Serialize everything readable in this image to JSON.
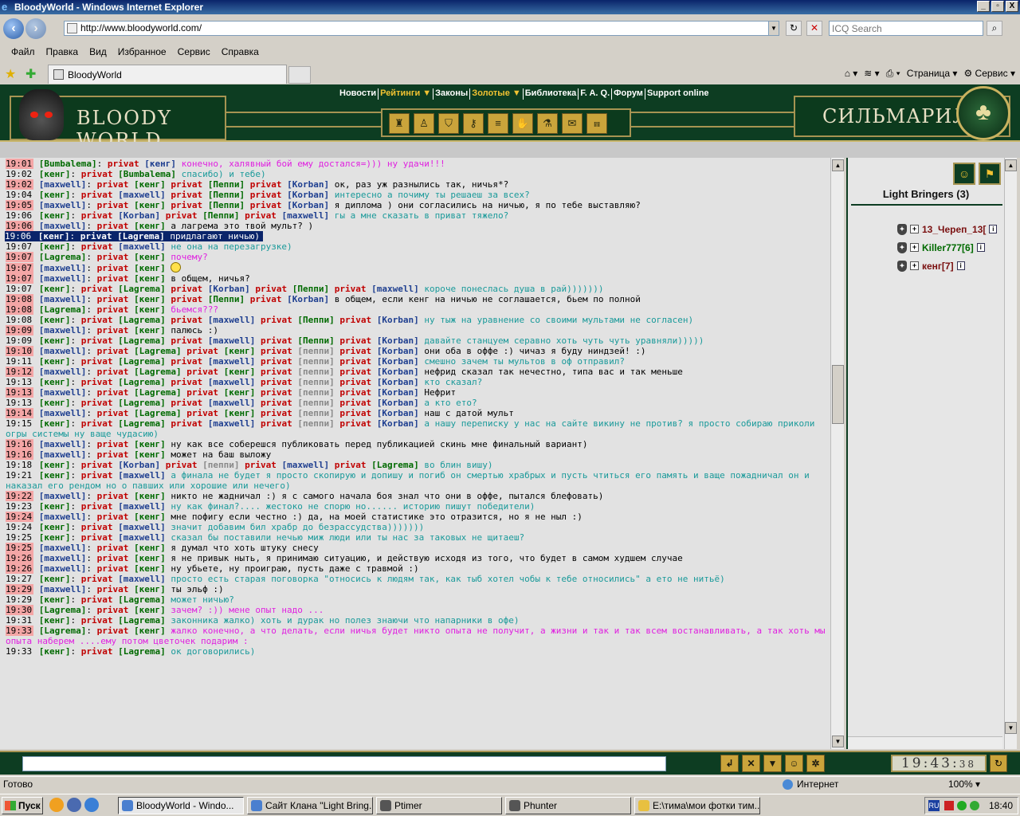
{
  "window": {
    "title": "BloodyWorld - Windows Internet Explorer",
    "controls": [
      "_",
      "▫",
      "X"
    ]
  },
  "address": {
    "url": "http://www.bloodyworld.com/",
    "search_placeholder": "ICQ Search"
  },
  "menu": [
    "Файл",
    "Правка",
    "Вид",
    "Избранное",
    "Сервис",
    "Справка"
  ],
  "tab": {
    "label": "BloodyWorld"
  },
  "ie_tools": {
    "page_label": "Страница",
    "service_label": "Сервис"
  },
  "site": {
    "nav": [
      "Новости",
      "Рейтинги ▼",
      "Законы",
      "Золотые ▼",
      "Библиотека",
      "F. A. Q.",
      "Форум",
      "Support online"
    ],
    "brand_left": "BLOODY WORLD",
    "brand_right": "СИЛЬМАРИЛ"
  },
  "chat": {
    "messages": [
      {
        "time": "19:01",
        "hl": true,
        "nick": "Bumbalema",
        "nick_color": "green",
        "targets": [
          {
            "name": "кенг",
            "c": "blue"
          }
        ],
        "text": "конечно, халявный бой ему достался=))) ну удачи!!!",
        "tc": "magenta"
      },
      {
        "time": "19:02",
        "hl": false,
        "nick": "кенг",
        "nick_color": "green",
        "targets": [
          {
            "name": "Bumbalema",
            "c": "green"
          }
        ],
        "text": "спасибо) и тебе)",
        "tc": "teal"
      },
      {
        "time": "19:02",
        "hl": true,
        "nick": "maxwell",
        "nick_color": "blue",
        "targets": [
          {
            "name": "кенг",
            "c": "green"
          },
          {
            "name": "Пеппи",
            "c": "green"
          },
          {
            "name": "Korban",
            "c": "blue"
          }
        ],
        "text": "ок, раз уж разнылись так, ничья*?",
        "tc": "navy"
      },
      {
        "time": "19:04",
        "hl": false,
        "nick": "кенг",
        "nick_color": "green",
        "targets": [
          {
            "name": "maxwell",
            "c": "blue"
          },
          {
            "name": "Пеппи",
            "c": "green"
          },
          {
            "name": "Korban",
            "c": "blue"
          }
        ],
        "text": "интересно а почиму ты решаеш за всех?",
        "tc": "teal"
      },
      {
        "time": "19:05",
        "hl": true,
        "nick": "maxwell",
        "nick_color": "blue",
        "targets": [
          {
            "name": "кенг",
            "c": "green"
          },
          {
            "name": "Пеппи",
            "c": "green"
          },
          {
            "name": "Korban",
            "c": "blue"
          }
        ],
        "text": "я диплома ) они согласились на ничью, я по тебе выставляю?",
        "tc": "navy"
      },
      {
        "time": "19:06",
        "hl": false,
        "nick": "кенг",
        "nick_color": "green",
        "targets": [
          {
            "name": "Korban",
            "c": "blue"
          },
          {
            "name": "Пеппи",
            "c": "green"
          },
          {
            "name": "maxwell",
            "c": "blue"
          }
        ],
        "text": "гы а мне сказать в приват тяжело?",
        "tc": "teal"
      },
      {
        "time": "19:06",
        "hl": true,
        "nick": "maxwell",
        "nick_color": "blue",
        "targets": [
          {
            "name": "кенг",
            "c": "green"
          }
        ],
        "text": "а лагрема это твой мульт? )",
        "tc": "navy"
      },
      {
        "time": "19:06",
        "hl": false,
        "sel": true,
        "nick": "кенг",
        "nick_color": "green",
        "targets": [
          {
            "name": "Lagrema",
            "c": "green"
          }
        ],
        "text": "придлагают ничью)",
        "tc": "teal"
      },
      {
        "time": "19:07",
        "hl": false,
        "nick": "кенг",
        "nick_color": "green",
        "targets": [
          {
            "name": "maxwell",
            "c": "blue"
          }
        ],
        "text": "не она на перезагрузке)",
        "tc": "teal"
      },
      {
        "time": "19:07",
        "hl": true,
        "nick": "Lagrema",
        "nick_color": "green",
        "targets": [
          {
            "name": "кенг",
            "c": "green"
          }
        ],
        "text": "почему?",
        "tc": "magenta"
      },
      {
        "time": "19:07",
        "hl": true,
        "nick": "maxwell",
        "nick_color": "blue",
        "targets": [
          {
            "name": "кенг",
            "c": "green"
          }
        ],
        "text": "",
        "tc": "navy",
        "smiley": true
      },
      {
        "time": "19:07",
        "hl": true,
        "nick": "maxwell",
        "nick_color": "blue",
        "targets": [
          {
            "name": "кенг",
            "c": "green"
          }
        ],
        "text": "в общем, ничья?",
        "tc": "navy"
      },
      {
        "time": "19:07",
        "hl": false,
        "nick": "кенг",
        "nick_color": "green",
        "targets": [
          {
            "name": "Lagrema",
            "c": "green"
          },
          {
            "name": "Korban",
            "c": "blue"
          },
          {
            "name": "Пеппи",
            "c": "green"
          },
          {
            "name": "maxwell",
            "c": "blue"
          }
        ],
        "text": "короче понеслась душа в рай)))))))",
        "tc": "teal"
      },
      {
        "time": "19:08",
        "hl": true,
        "nick": "maxwell",
        "nick_color": "blue",
        "targets": [
          {
            "name": "кенг",
            "c": "green"
          },
          {
            "name": "Пеппи",
            "c": "green"
          },
          {
            "name": "Korban",
            "c": "blue"
          }
        ],
        "text": "в общем, если кенг на ничью не соглашается, бьем по полной",
        "tc": "navy"
      },
      {
        "time": "19:08",
        "hl": true,
        "nick": "Lagrema",
        "nick_color": "green",
        "targets": [
          {
            "name": "кенг",
            "c": "green"
          }
        ],
        "text": "бьемся???",
        "tc": "magenta"
      },
      {
        "time": "19:08",
        "hl": false,
        "nick": "кенг",
        "nick_color": "green",
        "targets": [
          {
            "name": "Lagrema",
            "c": "green"
          },
          {
            "name": "maxwell",
            "c": "blue"
          },
          {
            "name": "Пеппи",
            "c": "green"
          },
          {
            "name": "Korban",
            "c": "blue"
          }
        ],
        "text": "ну тыж на уравнение со своими мультами не согласен)",
        "tc": "teal"
      },
      {
        "time": "19:09",
        "hl": true,
        "nick": "maxwell",
        "nick_color": "blue",
        "targets": [
          {
            "name": "кенг",
            "c": "green"
          }
        ],
        "text": "палюсь :)",
        "tc": "navy"
      },
      {
        "time": "19:09",
        "hl": false,
        "nick": "кенг",
        "nick_color": "green",
        "targets": [
          {
            "name": "Lagrema",
            "c": "green"
          },
          {
            "name": "maxwell",
            "c": "blue"
          },
          {
            "name": "Пеппи",
            "c": "green"
          },
          {
            "name": "Korban",
            "c": "blue"
          }
        ],
        "text": "давайте станцуем серавно хоть чуть чуть уравняли)))))",
        "tc": "teal"
      },
      {
        "time": "19:10",
        "hl": true,
        "nick": "maxwell",
        "nick_color": "blue",
        "targets": [
          {
            "name": "Lagrema",
            "c": "green"
          },
          {
            "name": "кенг",
            "c": "green"
          },
          {
            "name": "пеппи",
            "c": "gray"
          },
          {
            "name": "Korban",
            "c": "blue"
          }
        ],
        "text": "они оба в оффе :) чичаз я буду ниндзей! :)",
        "tc": "navy"
      },
      {
        "time": "19:11",
        "hl": false,
        "nick": "кенг",
        "nick_color": "green",
        "targets": [
          {
            "name": "Lagrema",
            "c": "green"
          },
          {
            "name": "maxwell",
            "c": "blue"
          },
          {
            "name": "пеппи",
            "c": "gray"
          },
          {
            "name": "Korban",
            "c": "blue"
          }
        ],
        "text": "смешно зачем ты мультов в оф отправил?",
        "tc": "teal"
      },
      {
        "time": "19:12",
        "hl": true,
        "nick": "maxwell",
        "nick_color": "blue",
        "targets": [
          {
            "name": "Lagrema",
            "c": "green"
          },
          {
            "name": "кенг",
            "c": "green"
          },
          {
            "name": "пеппи",
            "c": "gray"
          },
          {
            "name": "Korban",
            "c": "blue"
          }
        ],
        "text": "нефрид сказал так нечестно, типа вас и так меньше",
        "tc": "navy"
      },
      {
        "time": "19:13",
        "hl": false,
        "nick": "кенг",
        "nick_color": "green",
        "targets": [
          {
            "name": "Lagrema",
            "c": "green"
          },
          {
            "name": "maxwell",
            "c": "blue"
          },
          {
            "name": "пеппи",
            "c": "gray"
          },
          {
            "name": "Korban",
            "c": "blue"
          }
        ],
        "text": "кто сказал?",
        "tc": "teal"
      },
      {
        "time": "19:13",
        "hl": true,
        "nick": "maxwell",
        "nick_color": "blue",
        "targets": [
          {
            "name": "Lagrema",
            "c": "green"
          },
          {
            "name": "кенг",
            "c": "green"
          },
          {
            "name": "пеппи",
            "c": "gray"
          },
          {
            "name": "Korban",
            "c": "blue"
          }
        ],
        "text": "Нефрит",
        "tc": "navy"
      },
      {
        "time": "19:13",
        "hl": false,
        "nick": "кенг",
        "nick_color": "green",
        "targets": [
          {
            "name": "Lagrema",
            "c": "green"
          },
          {
            "name": "maxwell",
            "c": "blue"
          },
          {
            "name": "пеппи",
            "c": "gray"
          },
          {
            "name": "Korban",
            "c": "blue"
          }
        ],
        "text": "а кто ето?",
        "tc": "teal"
      },
      {
        "time": "19:14",
        "hl": true,
        "nick": "maxwell",
        "nick_color": "blue",
        "targets": [
          {
            "name": "Lagrema",
            "c": "green"
          },
          {
            "name": "кенг",
            "c": "green"
          },
          {
            "name": "пеппи",
            "c": "gray"
          },
          {
            "name": "Korban",
            "c": "blue"
          }
        ],
        "text": "наш с датой мульт",
        "tc": "navy"
      },
      {
        "time": "19:15",
        "hl": false,
        "nick": "кенг",
        "nick_color": "green",
        "targets": [
          {
            "name": "Lagrema",
            "c": "green"
          },
          {
            "name": "maxwell",
            "c": "blue"
          },
          {
            "name": "пеппи",
            "c": "gray"
          },
          {
            "name": "Korban",
            "c": "blue"
          }
        ],
        "text": "а нашу переписку у нас на сайте викину не против? я просто собираю приколи огры системы ну ваще чудасию)",
        "tc": "teal"
      },
      {
        "time": "19:16",
        "hl": true,
        "nick": "maxwell",
        "nick_color": "blue",
        "targets": [
          {
            "name": "кенг",
            "c": "green"
          }
        ],
        "text": "ну как все соберешся публиковать перед публикацией скинь мне финальный вариант)",
        "tc": "navy"
      },
      {
        "time": "19:16",
        "hl": true,
        "nick": "maxwell",
        "nick_color": "blue",
        "targets": [
          {
            "name": "кенг",
            "c": "green"
          }
        ],
        "text": "может на баш выложу",
        "tc": "navy"
      },
      {
        "time": "19:18",
        "hl": false,
        "nick": "кенг",
        "nick_color": "green",
        "targets": [
          {
            "name": "Korban",
            "c": "blue"
          },
          {
            "name": "пеппи",
            "c": "gray"
          },
          {
            "name": "maxwell",
            "c": "blue"
          },
          {
            "name": "Lagrema",
            "c": "green"
          }
        ],
        "text": "во блин вишу)",
        "tc": "teal"
      },
      {
        "time": "19:21",
        "hl": false,
        "nick": "кенг",
        "nick_color": "green",
        "targets": [
          {
            "name": "maxwell",
            "c": "blue"
          }
        ],
        "text": "а финала не будет я просто скопирую и допишу и погиб он смертью храбрых и пусть чтиться его память и ваще пожадничал он и наказал его рендом но о павших или хорошие или нечего)",
        "tc": "teal"
      },
      {
        "time": "19:22",
        "hl": true,
        "nick": "maxwell",
        "nick_color": "blue",
        "targets": [
          {
            "name": "кенг",
            "c": "green"
          }
        ],
        "text": "никто не жадничал :) я с самого начала боя знал что они в оффе, пытался блефовать)",
        "tc": "navy"
      },
      {
        "time": "19:23",
        "hl": false,
        "nick": "кенг",
        "nick_color": "green",
        "targets": [
          {
            "name": "maxwell",
            "c": "blue"
          }
        ],
        "text": "ну как финал?.... жестоко не спорю но...... историю пишут победители)",
        "tc": "teal"
      },
      {
        "time": "19:24",
        "hl": true,
        "nick": "maxwell",
        "nick_color": "blue",
        "targets": [
          {
            "name": "кенг",
            "c": "green"
          }
        ],
        "text": "мне пофигу если честно :) да, на моей статистике это отразится, но я не ныл :)",
        "tc": "navy"
      },
      {
        "time": "19:24",
        "hl": false,
        "nick": "кенг",
        "nick_color": "green",
        "targets": [
          {
            "name": "maxwell",
            "c": "blue"
          }
        ],
        "text": "значит добавим бил храбр до безрассудства)))))))",
        "tc": "teal"
      },
      {
        "time": "19:25",
        "hl": false,
        "nick": "кенг",
        "nick_color": "green",
        "targets": [
          {
            "name": "maxwell",
            "c": "blue"
          }
        ],
        "text": "сказал бы поставили нечью миж люди или ты нас за таковых не щитаеш?",
        "tc": "teal"
      },
      {
        "time": "19:25",
        "hl": true,
        "nick": "maxwell",
        "nick_color": "blue",
        "targets": [
          {
            "name": "кенг",
            "c": "green"
          }
        ],
        "text": "я думал что хоть штуку снесу",
        "tc": "navy"
      },
      {
        "time": "19:26",
        "hl": true,
        "nick": "maxwell",
        "nick_color": "blue",
        "targets": [
          {
            "name": "кенг",
            "c": "green"
          }
        ],
        "text": "я не привык ныть, я принимаю ситуацию, и действую исходя из того, что будет в самом худшем случае",
        "tc": "navy"
      },
      {
        "time": "19:26",
        "hl": true,
        "nick": "maxwell",
        "nick_color": "blue",
        "targets": [
          {
            "name": "кенг",
            "c": "green"
          }
        ],
        "text": "ну убьете, ну проиграю, пусть даже с травмой :)",
        "tc": "navy"
      },
      {
        "time": "19:27",
        "hl": false,
        "nick": "кенг",
        "nick_color": "green",
        "targets": [
          {
            "name": "maxwell",
            "c": "blue"
          }
        ],
        "text": "просто есть старая поговорка \"относись к людям так, как тыб хотел чобы к тебе относились\" а ето не нитьё)",
        "tc": "teal"
      },
      {
        "time": "19:29",
        "hl": true,
        "nick": "maxwell",
        "nick_color": "blue",
        "targets": [
          {
            "name": "кенг",
            "c": "green"
          }
        ],
        "text": "ты эльф :)",
        "tc": "navy"
      },
      {
        "time": "19:29",
        "hl": false,
        "nick": "кенг",
        "nick_color": "green",
        "targets": [
          {
            "name": "Lagrema",
            "c": "green"
          }
        ],
        "text": "может ничью?",
        "tc": "teal"
      },
      {
        "time": "19:30",
        "hl": true,
        "nick": "Lagrema",
        "nick_color": "green",
        "targets": [
          {
            "name": "кенг",
            "c": "green"
          }
        ],
        "text": "зачем? :)) мене опыт надо ...",
        "tc": "magenta"
      },
      {
        "time": "19:31",
        "hl": false,
        "nick": "кенг",
        "nick_color": "green",
        "targets": [
          {
            "name": "Lagrema",
            "c": "green"
          }
        ],
        "text": "законника жалко) хоть и дурак но полез знаючи что напарники в офе)",
        "tc": "teal"
      },
      {
        "time": "19:33",
        "hl": true,
        "nick": "Lagrema",
        "nick_color": "green",
        "targets": [
          {
            "name": "кенг",
            "c": "green"
          }
        ],
        "text": "жалко конечно, а что делать, если ничья будет никто опыта не получит, а жизни и так и так всем востанавливать, а так хоть мы опыта наберем ....ему потом цветочек подарим :",
        "tc": "magenta"
      },
      {
        "time": "19:33",
        "hl": false,
        "nick": "кенг",
        "nick_color": "green",
        "targets": [
          {
            "name": "Lagrema",
            "c": "green"
          }
        ],
        "text": "ок договорились)",
        "tc": "teal"
      }
    ]
  },
  "clan": {
    "title": "Light Bringers (3)",
    "members": [
      {
        "name": "13_Череп_13[",
        "color": "r"
      },
      {
        "name": "Killer777[6]",
        "color": "g"
      },
      {
        "name": "кенг[7]",
        "color": "r"
      }
    ]
  },
  "clock": {
    "time": "19:43",
    "seconds": "38"
  },
  "statusbar": {
    "text": "Готово",
    "zone": "Интернет",
    "zoom": "100%"
  },
  "taskbar": {
    "start": "Пуск",
    "items": [
      "BloodyWorld - Windo...",
      "Сайт Клана \"Light Bring...",
      "Ptimer",
      "Phunter",
      "E:\\тима\\мои фотки тим..."
    ],
    "tray_lang": "RU",
    "tray_time": "18:40"
  },
  "private_word": "privat"
}
